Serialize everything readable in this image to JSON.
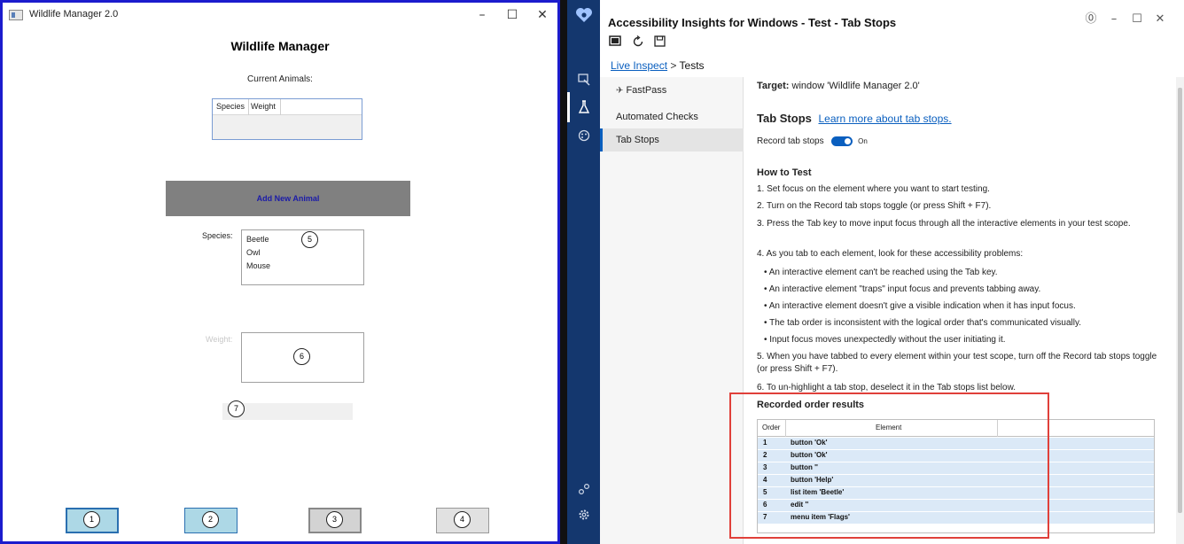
{
  "wildlife_manager": {
    "window_title": "Wildlife Manager 2.0",
    "caption_buttons": [
      "–",
      "☐",
      "✕"
    ],
    "heading": "Wildlife Manager",
    "current_animals_label": "Current Animals:",
    "list_columns": [
      "Species",
      "Weight"
    ],
    "add_button_label": "Add New Animal",
    "species_label": "Species:",
    "species_items": [
      "Beetle",
      "Owl",
      "Mouse"
    ],
    "weight_label": "Weight:",
    "tab_markers": [
      "1",
      "2",
      "3",
      "4",
      "5",
      "6",
      "7"
    ]
  },
  "accessibility_insights": {
    "window_title": "Accessibility Insights for Windows - Test - Tab Stops",
    "caption_buttons": [
      "⓪",
      "–",
      "☐",
      "✕"
    ],
    "breadcrumb": {
      "link": "Live Inspect",
      "separator": ">",
      "current": "Tests"
    },
    "nav_items": [
      "FastPass",
      "Automated Checks",
      "Tab Stops"
    ],
    "target_label": "Target:",
    "target_value": "window 'Wildlife Manager 2.0'",
    "tab_stops_heading": "Tab Stops",
    "learn_more_link": "Learn more about tab stops.",
    "record_label": "Record tab stops",
    "toggle_state": "On",
    "how_to_heading": "How to Test",
    "steps": [
      "1. Set focus on the element where you want to start testing.",
      "2. Turn on the Record tab stops toggle (or press Shift + F7).",
      "3. Press the Tab key to move input focus through all the interactive elements in your test scope.",
      "4. As you tab to each element, look for these accessibility problems:",
      "5. When you have tabbed to every element within your test scope, turn off the Record tab stops toggle (or press Shift + F7).",
      "6. To un-highlight a tab stop, deselect it in the Tab stops list below."
    ],
    "bullets": [
      "• An interactive element can't be reached using the Tab key.",
      "• An interactive element \"traps\" input focus and prevents tabbing away.",
      "• An interactive element doesn't give a visible indication when it has input focus.",
      "• The tab order is inconsistent with the logical order that's communicated visually.",
      "• Input focus moves unexpectedly without the user initiating it."
    ],
    "recorded_heading": "Recorded order results",
    "table_headers": [
      "Order",
      "Element"
    ],
    "table_rows": [
      {
        "order": "1",
        "element": "button 'Ok'"
      },
      {
        "order": "2",
        "element": "button 'Ok'"
      },
      {
        "order": "3",
        "element": "button ''"
      },
      {
        "order": "4",
        "element": "button 'Help'"
      },
      {
        "order": "5",
        "element": "list item 'Beetle'"
      },
      {
        "order": "6",
        "element": "edit ''"
      },
      {
        "order": "7",
        "element": "menu item 'Flags'"
      }
    ],
    "highlight_color": "#e0403a",
    "accent_color": "#0a5fbf",
    "sidebar_color": "#14376e"
  }
}
